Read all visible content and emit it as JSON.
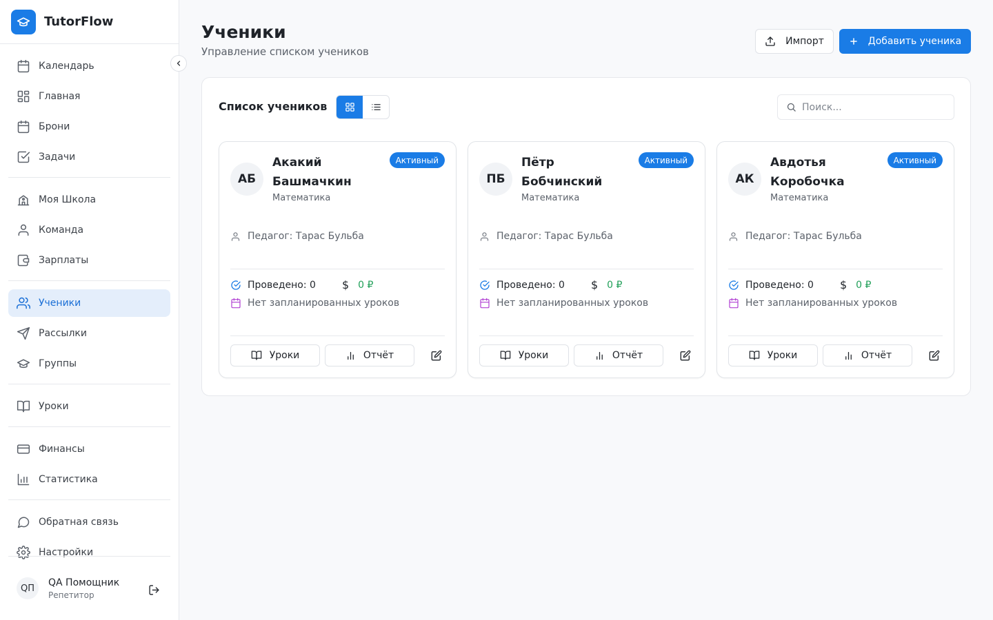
{
  "app": {
    "name": "TutorFlow",
    "logo_icon": "graduation-cap-icon",
    "accent": "#1a7ce6"
  },
  "sidebar": {
    "groups": [
      [
        {
          "label": "Календарь",
          "icon": "calendar-icon"
        },
        {
          "label": "Главная",
          "icon": "dashboard-icon"
        },
        {
          "label": "Брони",
          "icon": "calendar-icon"
        },
        {
          "label": "Задачи",
          "icon": "checkbox-icon"
        }
      ],
      [
        {
          "label": "Моя Школа",
          "icon": "school-icon"
        },
        {
          "label": "Команда",
          "icon": "user-icon"
        },
        {
          "label": "Зарплаты",
          "icon": "wallet-icon"
        }
      ],
      [
        {
          "label": "Ученики",
          "icon": "users-icon",
          "active": true
        },
        {
          "label": "Рассылки",
          "icon": "send-icon"
        },
        {
          "label": "Группы",
          "icon": "graduation-cap-icon"
        }
      ],
      [
        {
          "label": "Уроки",
          "icon": "book-icon"
        }
      ],
      [
        {
          "label": "Финансы",
          "icon": "credit-card-icon"
        },
        {
          "label": "Статистика",
          "icon": "bar-chart-icon"
        }
      ],
      [
        {
          "label": "Обратная связь",
          "icon": "message-icon"
        },
        {
          "label": "Настройки",
          "icon": "gear-icon"
        }
      ]
    ],
    "user": {
      "initials": "QП",
      "name": "QA Помощник",
      "role": "Репетитор"
    }
  },
  "header": {
    "title": "Ученики",
    "subtitle": "Управление списком учеников",
    "import_label": "Импорт",
    "add_label": "Добавить ученика"
  },
  "panel": {
    "title": "Список учеников",
    "view_mode": "grid",
    "search_placeholder": "Поиск..."
  },
  "students": [
    {
      "initials": "АБ",
      "first": "Акакий",
      "last": "Башмачкин",
      "subject": "Математика",
      "status": "Активный",
      "teacher": "Педагог: Тарас Бульба",
      "held": "Проведено: 0",
      "money_symbol": "$",
      "amount": "0 ₽",
      "plan": "Нет запланированных уроков",
      "lessons_label": "Уроки",
      "report_label": "Отчёт"
    },
    {
      "initials": "ПБ",
      "first": "Пётр",
      "last": "Бобчинский",
      "subject": "Математика",
      "status": "Активный",
      "teacher": "Педагог: Тарас Бульба",
      "held": "Проведено: 0",
      "money_symbol": "$",
      "amount": "0 ₽",
      "plan": "Нет запланированных уроков",
      "lessons_label": "Уроки",
      "report_label": "Отчёт"
    },
    {
      "initials": "АК",
      "first": "Авдотья",
      "last": "Коробочка",
      "subject": "Математика",
      "status": "Активный",
      "teacher": "Педагог: Тарас Бульба",
      "held": "Проведено: 0",
      "money_symbol": "$",
      "amount": "0 ₽",
      "plan": "Нет запланированных уроков",
      "lessons_label": "Уроки",
      "report_label": "Отчёт"
    }
  ]
}
